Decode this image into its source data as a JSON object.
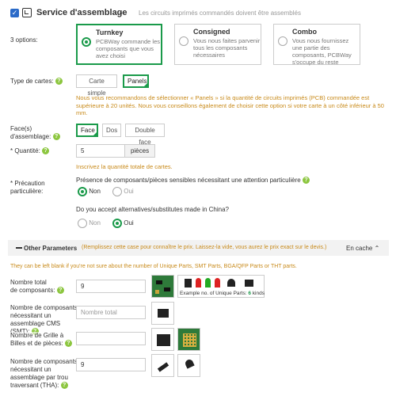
{
  "header": {
    "title": "Service d'assemblage",
    "subtitle": "Les circuits imprimés commandés doivent être assemblés"
  },
  "options": {
    "label": "3 options:",
    "cards": [
      {
        "title": "Turnkey",
        "desc": "PCBWay commande les composants que vous avez choisi",
        "selected": true
      },
      {
        "title": "Consigned",
        "desc": "Vous nous faites parvenir tous les composants nécessaires",
        "selected": false
      },
      {
        "title": "Combo",
        "desc": "Vous nous fournissez une partie des composants, PCBWay s'occupe du reste",
        "selected": false
      }
    ]
  },
  "board_type": {
    "label": "Type de cartes:",
    "options": [
      "Carte simple",
      "Panels"
    ],
    "selected": "Panels",
    "note": "Nous vous recommandons de sélectionner « Panels » si la quantité de circuits imprimés (PCB) commandée est supérieure à 20 unités. Nous vous conseillons également de choisir cette option si votre carte à un côté inférieur à 50 mm."
  },
  "faces": {
    "label_line1": "Face(s)",
    "label_line2": "d'assemblage:",
    "options": [
      "Face",
      "Dos",
      "Double face"
    ],
    "selected": "Face"
  },
  "quantity": {
    "label": "* Quantité:",
    "value": "5",
    "unit": "pièces",
    "hint": "Inscrivez la quantité totale de cartes."
  },
  "precaution": {
    "label_line1": "* Précaution",
    "label_line2": "particulière:",
    "q1": "Présence de composants/pièces sensibles nécessitant une attention particulière",
    "q1_yes": "Oui",
    "q1_no": "Non",
    "q1_selected": "Non",
    "q2": "Do you accept alternatives/substitutes made in China?",
    "q2_yes": "Oui",
    "q2_no": "Non",
    "q2_selected": "Oui"
  },
  "other": {
    "title": "Other Parameters",
    "hint": "(Remplissez cette case pour connaître le prix. Laissez-la vide, vous aurez le prix exact sur le devis.)",
    "toggle": "En cache",
    "blank_note": "They can be left blank if you're not sure about the number of Unique Parts, SMT Parts, BGA/QFP Parts or THT parts.",
    "total_label_1": "Nombre total",
    "total_label_2": "de composants:",
    "total_value": "9",
    "example_text": "Example no. of Unique Parts:",
    "example_count": "6",
    "example_kinds": "kinds",
    "smt_label_1": "Nombre de composants",
    "smt_label_2": "nécessitant un",
    "smt_label_3": "assemblage CMS",
    "smt_label_4": "(SMT):",
    "smt_placeholder": "Nombre total",
    "bga_label_1": "Nombre de Grille à",
    "bga_label_2": "Billes et de pièces:",
    "tht_label_1": "Nombre de composants",
    "tht_label_2": "nécessitant un",
    "tht_label_3": "assemblage par trou",
    "tht_label_4": "traversant (THA):",
    "tht_value": "9"
  },
  "colors": {
    "accent": "#1a9a4a",
    "warning": "#c88a1a",
    "help": "#8cc63f"
  }
}
